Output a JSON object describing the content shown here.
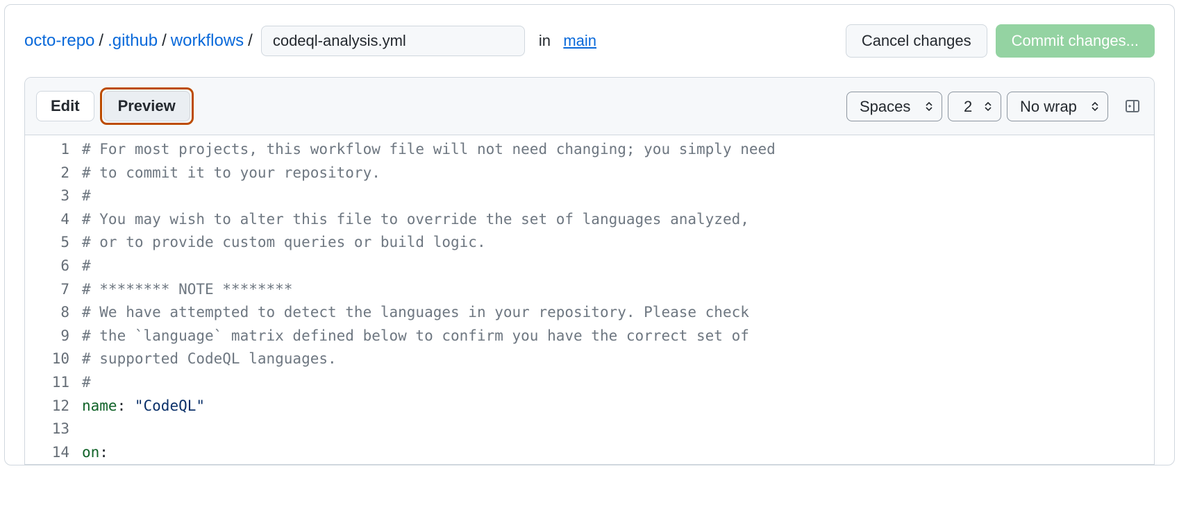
{
  "breadcrumbs": {
    "repo": "octo-repo",
    "segments": [
      ".github",
      "workflows"
    ],
    "filename": "codeql-analysis.yml",
    "in_label": "in",
    "branch": "main"
  },
  "actions": {
    "cancel": "Cancel changes",
    "commit": "Commit changes..."
  },
  "tabs": {
    "edit": "Edit",
    "preview": "Preview"
  },
  "toolbar": {
    "indent_mode": "Spaces",
    "indent_size": "2",
    "wrap_mode": "No wrap"
  },
  "code": {
    "lines": [
      {
        "n": 1,
        "t": "comment",
        "text": "# For most projects, this workflow file will not need changing; you simply need"
      },
      {
        "n": 2,
        "t": "comment",
        "text": "# to commit it to your repository."
      },
      {
        "n": 3,
        "t": "comment",
        "text": "#"
      },
      {
        "n": 4,
        "t": "comment",
        "text": "# You may wish to alter this file to override the set of languages analyzed,"
      },
      {
        "n": 5,
        "t": "comment",
        "text": "# or to provide custom queries or build logic."
      },
      {
        "n": 6,
        "t": "comment",
        "text": "#"
      },
      {
        "n": 7,
        "t": "comment",
        "text": "# ******** NOTE ********"
      },
      {
        "n": 8,
        "t": "comment",
        "text": "# We have attempted to detect the languages in your repository. Please check"
      },
      {
        "n": 9,
        "t": "comment",
        "text": "# the `language` matrix defined below to confirm you have the correct set of"
      },
      {
        "n": 10,
        "t": "comment",
        "text": "# supported CodeQL languages."
      },
      {
        "n": 11,
        "t": "comment",
        "text": "#"
      },
      {
        "n": 12,
        "t": "kv",
        "key": "name",
        "sep": ": ",
        "val": "\"CodeQL\""
      },
      {
        "n": 13,
        "t": "blank",
        "text": ""
      },
      {
        "n": 14,
        "t": "kv",
        "key": "on",
        "sep": ":",
        "val": ""
      }
    ]
  }
}
